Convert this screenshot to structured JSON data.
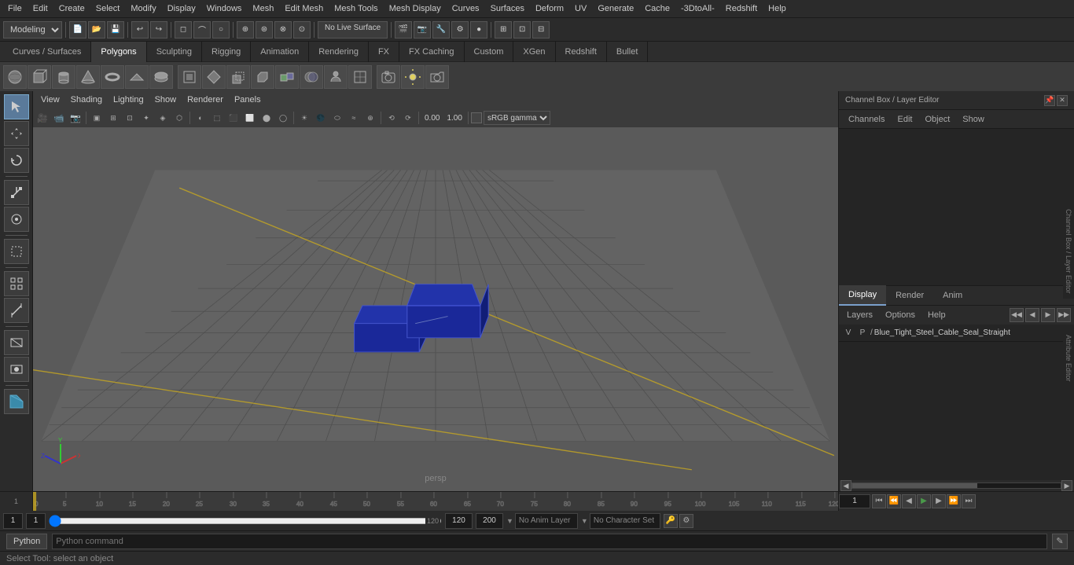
{
  "menubar": {
    "items": [
      "File",
      "Edit",
      "Create",
      "Select",
      "Modify",
      "Display",
      "Windows",
      "Mesh",
      "Edit Mesh",
      "Mesh Tools",
      "Mesh Display",
      "Curves",
      "Surfaces",
      "Deform",
      "UV",
      "Generate",
      "Cache",
      "-3DtoAll-",
      "Redshift",
      "Help"
    ]
  },
  "toolbar1": {
    "mode": "Modeling",
    "live_surface": "No Live Surface"
  },
  "tabs": {
    "items": [
      "Curves / Surfaces",
      "Polygons",
      "Sculpting",
      "Rigging",
      "Animation",
      "Rendering",
      "FX",
      "FX Caching",
      "Custom",
      "XGen",
      "Redshift",
      "Bullet"
    ],
    "active": "Polygons"
  },
  "viewport": {
    "menu": [
      "View",
      "Shading",
      "Lighting",
      "Show",
      "Renderer",
      "Panels"
    ],
    "label": "persp",
    "color_mode": "sRGB gamma"
  },
  "right_panel": {
    "title": "Channel Box / Layer Editor",
    "channel_tabs": [
      "Channels",
      "Edit",
      "Object",
      "Show"
    ],
    "vertical_labels": [
      "Channel Box / Layer Editor",
      "Attribute Editor"
    ],
    "display_tabs": [
      "Display",
      "Render",
      "Anim"
    ],
    "active_display_tab": "Display",
    "layer_bar": [
      "Layers",
      "Options",
      "Help"
    ],
    "layer_row": {
      "v": "V",
      "p": "P",
      "name": "Blue_Tight_Steel_Cable_Seal_Straight"
    },
    "layer_icons": [
      "◀◀",
      "◀",
      "▶",
      "▶▶"
    ]
  },
  "timeline": {
    "start": 1,
    "end": 120,
    "current": 1,
    "ticks": [
      0,
      5,
      10,
      15,
      20,
      25,
      30,
      35,
      40,
      45,
      50,
      55,
      60,
      65,
      70,
      75,
      80,
      85,
      90,
      95,
      100,
      105,
      110,
      115,
      120
    ]
  },
  "status_bar": {
    "frame_start": "1",
    "frame_current": "1",
    "frame_range_start": "1",
    "anim_end": "120",
    "anim_end2": "120",
    "playback_end": "200",
    "no_anim_layer": "No Anim Layer",
    "no_char_set": "No Character Set",
    "playback_buttons": [
      "⏮",
      "⏪",
      "◀",
      "▶",
      "⏩",
      "⏭"
    ]
  },
  "bottom_bar": {
    "python_label": "Python",
    "status_text": "Select Tool: select an object"
  },
  "left_tools": {
    "tools": [
      "↖",
      "↗",
      "↔",
      "⟳",
      "⤢",
      "⊞",
      "▣"
    ]
  }
}
